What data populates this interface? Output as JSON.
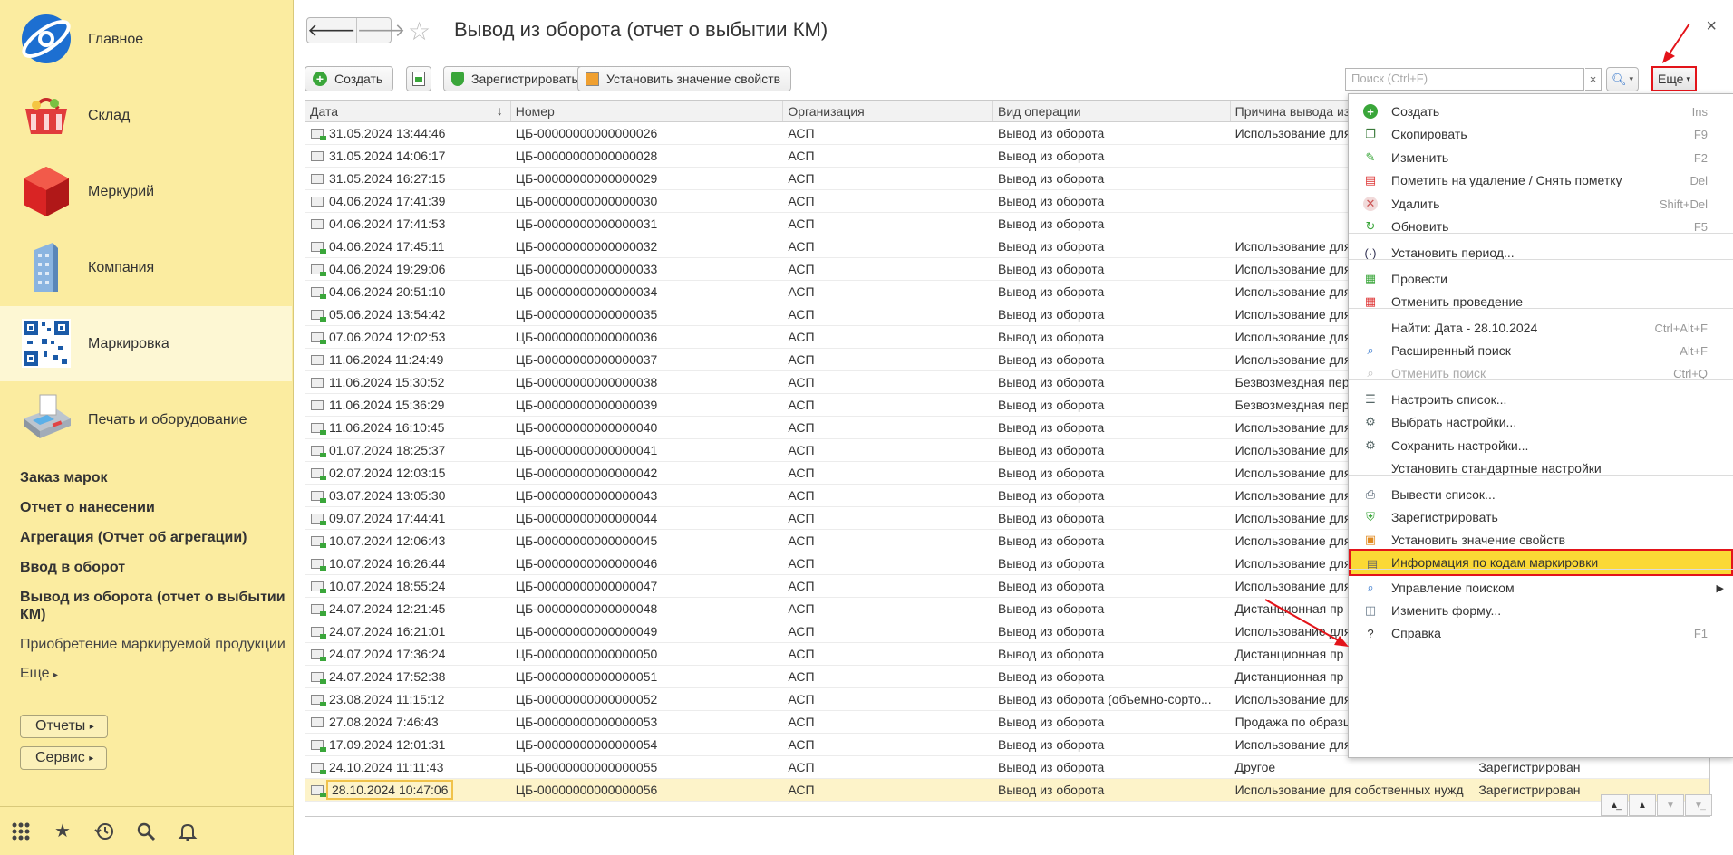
{
  "sidebar": {
    "sections": [
      {
        "label": "Главное",
        "icon": "globe-logo-icon"
      },
      {
        "label": "Склад",
        "icon": "basket-icon"
      },
      {
        "label": "Меркурий",
        "icon": "red-cube-icon"
      },
      {
        "label": "Компания",
        "icon": "building-icon"
      },
      {
        "label": "Маркировка",
        "icon": "qr-code-icon"
      },
      {
        "label": "Печать и оборудование",
        "icon": "card-terminal-icon"
      }
    ],
    "links": [
      "Заказ марок",
      "Отчет о нанесении",
      "Агрегация (Отчет об агрегации)",
      "Ввод в оборот",
      "Вывод из оборота (отчет о выбытии КМ)"
    ],
    "normal_link": "Приобретение маркируемой продукции",
    "more_label": "Еще",
    "reports_btn": "Отчеты",
    "service_btn": "Сервис"
  },
  "header": {
    "title": "Вывод из оборота (отчет о выбытии КМ)",
    "close": "×"
  },
  "toolbar": {
    "create": "Создать",
    "register": "Зарегистрировать",
    "set_props": "Установить значение свойств",
    "search_placeholder": "Поиск (Ctrl+F)",
    "search_clear": "×",
    "more": "Еще"
  },
  "table": {
    "columns": [
      "Дата",
      "Номер",
      "Организация",
      "Вид операции",
      "Причина вывода из",
      ""
    ],
    "rows": [
      {
        "date": "31.05.2024 13:44:46",
        "num": "ЦБ-00000000000000026",
        "org": "АСП",
        "op": "Вывод из оборота",
        "reason": "Использование для",
        "status": "",
        "posted": true
      },
      {
        "date": "31.05.2024 14:06:17",
        "num": "ЦБ-00000000000000028",
        "org": "АСП",
        "op": "Вывод из оборота",
        "reason": "",
        "status": "",
        "posted": false
      },
      {
        "date": "31.05.2024 16:27:15",
        "num": "ЦБ-00000000000000029",
        "org": "АСП",
        "op": "Вывод из оборота",
        "reason": "",
        "status": "",
        "posted": false
      },
      {
        "date": "04.06.2024 17:41:39",
        "num": "ЦБ-00000000000000030",
        "org": "АСП",
        "op": "Вывод из оборота",
        "reason": "",
        "status": "",
        "posted": false
      },
      {
        "date": "04.06.2024 17:41:53",
        "num": "ЦБ-00000000000000031",
        "org": "АСП",
        "op": "Вывод из оборота",
        "reason": "",
        "status": "",
        "posted": false
      },
      {
        "date": "04.06.2024 17:45:11",
        "num": "ЦБ-00000000000000032",
        "org": "АСП",
        "op": "Вывод из оборота",
        "reason": "Использование для",
        "status": "",
        "posted": true
      },
      {
        "date": "04.06.2024 19:29:06",
        "num": "ЦБ-00000000000000033",
        "org": "АСП",
        "op": "Вывод из оборота",
        "reason": "Использование для",
        "status": "",
        "posted": true
      },
      {
        "date": "04.06.2024 20:51:10",
        "num": "ЦБ-00000000000000034",
        "org": "АСП",
        "op": "Вывод из оборота",
        "reason": "Использование для",
        "status": "",
        "posted": true
      },
      {
        "date": "05.06.2024 13:54:42",
        "num": "ЦБ-00000000000000035",
        "org": "АСП",
        "op": "Вывод из оборота",
        "reason": "Использование для",
        "status": "",
        "posted": true
      },
      {
        "date": "07.06.2024 12:02:53",
        "num": "ЦБ-00000000000000036",
        "org": "АСП",
        "op": "Вывод из оборота",
        "reason": "Использование для",
        "status": "",
        "posted": true
      },
      {
        "date": "11.06.2024 11:24:49",
        "num": "ЦБ-00000000000000037",
        "org": "АСП",
        "op": "Вывод из оборота",
        "reason": "Использование для",
        "status": "",
        "posted": false
      },
      {
        "date": "11.06.2024 15:30:52",
        "num": "ЦБ-00000000000000038",
        "org": "АСП",
        "op": "Вывод из оборота",
        "reason": "Безвозмездная пер",
        "status": "",
        "posted": false
      },
      {
        "date": "11.06.2024 15:36:29",
        "num": "ЦБ-00000000000000039",
        "org": "АСП",
        "op": "Вывод из оборота",
        "reason": "Безвозмездная пер",
        "status": "",
        "posted": false
      },
      {
        "date": "11.06.2024 16:10:45",
        "num": "ЦБ-00000000000000040",
        "org": "АСП",
        "op": "Вывод из оборота",
        "reason": "Использование для",
        "status": "",
        "posted": true
      },
      {
        "date": "01.07.2024 18:25:37",
        "num": "ЦБ-00000000000000041",
        "org": "АСП",
        "op": "Вывод из оборота",
        "reason": "Использование для",
        "status": "",
        "posted": true
      },
      {
        "date": "02.07.2024 12:03:15",
        "num": "ЦБ-00000000000000042",
        "org": "АСП",
        "op": "Вывод из оборота",
        "reason": "Использование для",
        "status": "",
        "posted": true
      },
      {
        "date": "03.07.2024 13:05:30",
        "num": "ЦБ-00000000000000043",
        "org": "АСП",
        "op": "Вывод из оборота",
        "reason": "Использование для",
        "status": "",
        "posted": true
      },
      {
        "date": "09.07.2024 17:44:41",
        "num": "ЦБ-00000000000000044",
        "org": "АСП",
        "op": "Вывод из оборота",
        "reason": "Использование для",
        "status": "",
        "posted": true
      },
      {
        "date": "10.07.2024 12:06:43",
        "num": "ЦБ-00000000000000045",
        "org": "АСП",
        "op": "Вывод из оборота",
        "reason": "Использование для",
        "status": "",
        "posted": true
      },
      {
        "date": "10.07.2024 16:26:44",
        "num": "ЦБ-00000000000000046",
        "org": "АСП",
        "op": "Вывод из оборота",
        "reason": "Использование для",
        "status": "",
        "posted": true
      },
      {
        "date": "10.07.2024 18:55:24",
        "num": "ЦБ-00000000000000047",
        "org": "АСП",
        "op": "Вывод из оборота",
        "reason": "Использование для",
        "status": "",
        "posted": true
      },
      {
        "date": "24.07.2024 12:21:45",
        "num": "ЦБ-00000000000000048",
        "org": "АСП",
        "op": "Вывод из оборота",
        "reason": "Дистанционная пр",
        "status": "",
        "posted": true
      },
      {
        "date": "24.07.2024 16:21:01",
        "num": "ЦБ-00000000000000049",
        "org": "АСП",
        "op": "Вывод из оборота",
        "reason": "Использование для",
        "status": "",
        "posted": true
      },
      {
        "date": "24.07.2024 17:36:24",
        "num": "ЦБ-00000000000000050",
        "org": "АСП",
        "op": "Вывод из оборота",
        "reason": "Дистанционная пр",
        "status": "",
        "posted": true
      },
      {
        "date": "24.07.2024 17:52:38",
        "num": "ЦБ-00000000000000051",
        "org": "АСП",
        "op": "Вывод из оборота",
        "reason": "Дистанционная пр",
        "status": "",
        "posted": true
      },
      {
        "date": "23.08.2024 11:15:12",
        "num": "ЦБ-00000000000000052",
        "org": "АСП",
        "op": "Вывод из оборота (объемно-сорто...",
        "reason": "Использование для",
        "status": "",
        "posted": true
      },
      {
        "date": "27.08.2024 7:46:43",
        "num": "ЦБ-00000000000000053",
        "org": "АСП",
        "op": "Вывод из оборота",
        "reason": "Продажа по образц",
        "status": "",
        "posted": false
      },
      {
        "date": "17.09.2024 12:01:31",
        "num": "ЦБ-00000000000000054",
        "org": "АСП",
        "op": "Вывод из оборота",
        "reason": "Использование для",
        "status": "",
        "posted": true
      },
      {
        "date": "24.10.2024 11:11:43",
        "num": "ЦБ-00000000000000055",
        "org": "АСП",
        "op": "Вывод из оборота",
        "reason": "Другое",
        "status": "Зарегистрирован",
        "posted": true
      },
      {
        "date": "28.10.2024 10:47:06",
        "num": "ЦБ-00000000000000056",
        "org": "АСП",
        "op": "Вывод из оборота",
        "reason": "Использование для собственных нужд",
        "status": "Зарегистрирован",
        "posted": true
      }
    ]
  },
  "menu": {
    "items": [
      {
        "label": "Создать",
        "shortcut": "Ins",
        "icon": "plus-circle-icon"
      },
      {
        "label": "Скопировать",
        "shortcut": "F9",
        "icon": "copy-icon"
      },
      {
        "label": "Изменить",
        "shortcut": "F2",
        "icon": "pencil-icon"
      },
      {
        "label": "Пометить на удаление / Снять пометку",
        "shortcut": "Del",
        "icon": "mark-delete-icon"
      },
      {
        "label": "Удалить",
        "shortcut": "Shift+Del",
        "icon": "delete-icon"
      },
      {
        "label": "Обновить",
        "shortcut": "F5",
        "icon": "refresh-icon"
      },
      {
        "label": "Установить период...",
        "shortcut": "",
        "icon": "period-icon"
      },
      {
        "label": "Провести",
        "shortcut": "",
        "icon": "post-icon"
      },
      {
        "label": "Отменить проведение",
        "shortcut": "",
        "icon": "unpost-icon"
      },
      {
        "label": "Найти: Дата - 28.10.2024",
        "shortcut": "Ctrl+Alt+F",
        "icon": ""
      },
      {
        "label": "Расширенный поиск",
        "shortcut": "Alt+F",
        "icon": "search-icon"
      },
      {
        "label": "Отменить поиск",
        "shortcut": "Ctrl+Q",
        "icon": "cancel-search-icon"
      },
      {
        "label": "Настроить список...",
        "shortcut": "",
        "icon": "list-settings-icon"
      },
      {
        "label": "Выбрать настройки...",
        "shortcut": "",
        "icon": "choose-settings-icon"
      },
      {
        "label": "Сохранить настройки...",
        "shortcut": "",
        "icon": "save-settings-icon"
      },
      {
        "label": "Установить стандартные настройки",
        "shortcut": "",
        "icon": ""
      },
      {
        "label": "Вывести список...",
        "shortcut": "",
        "icon": "print-list-icon"
      },
      {
        "label": "Зарегистрировать",
        "shortcut": "",
        "icon": "shield-icon"
      },
      {
        "label": "Установить значение свойств",
        "shortcut": "",
        "icon": "properties-icon"
      },
      {
        "label": "Информация по кодам маркировки",
        "shortcut": "",
        "icon": "document-icon"
      },
      {
        "label": "Управление поиском",
        "shortcut": "",
        "icon": "search-icon"
      },
      {
        "label": "Изменить форму...",
        "shortcut": "",
        "icon": "form-icon"
      },
      {
        "label": "Справка",
        "shortcut": "F1",
        "icon": "help-icon"
      }
    ]
  },
  "colors": {
    "sidebar_bg": "#fbeca0",
    "highlight": "#fbd935",
    "annotation_red": "#e3141a",
    "selected_row": "#fdf3c9"
  }
}
